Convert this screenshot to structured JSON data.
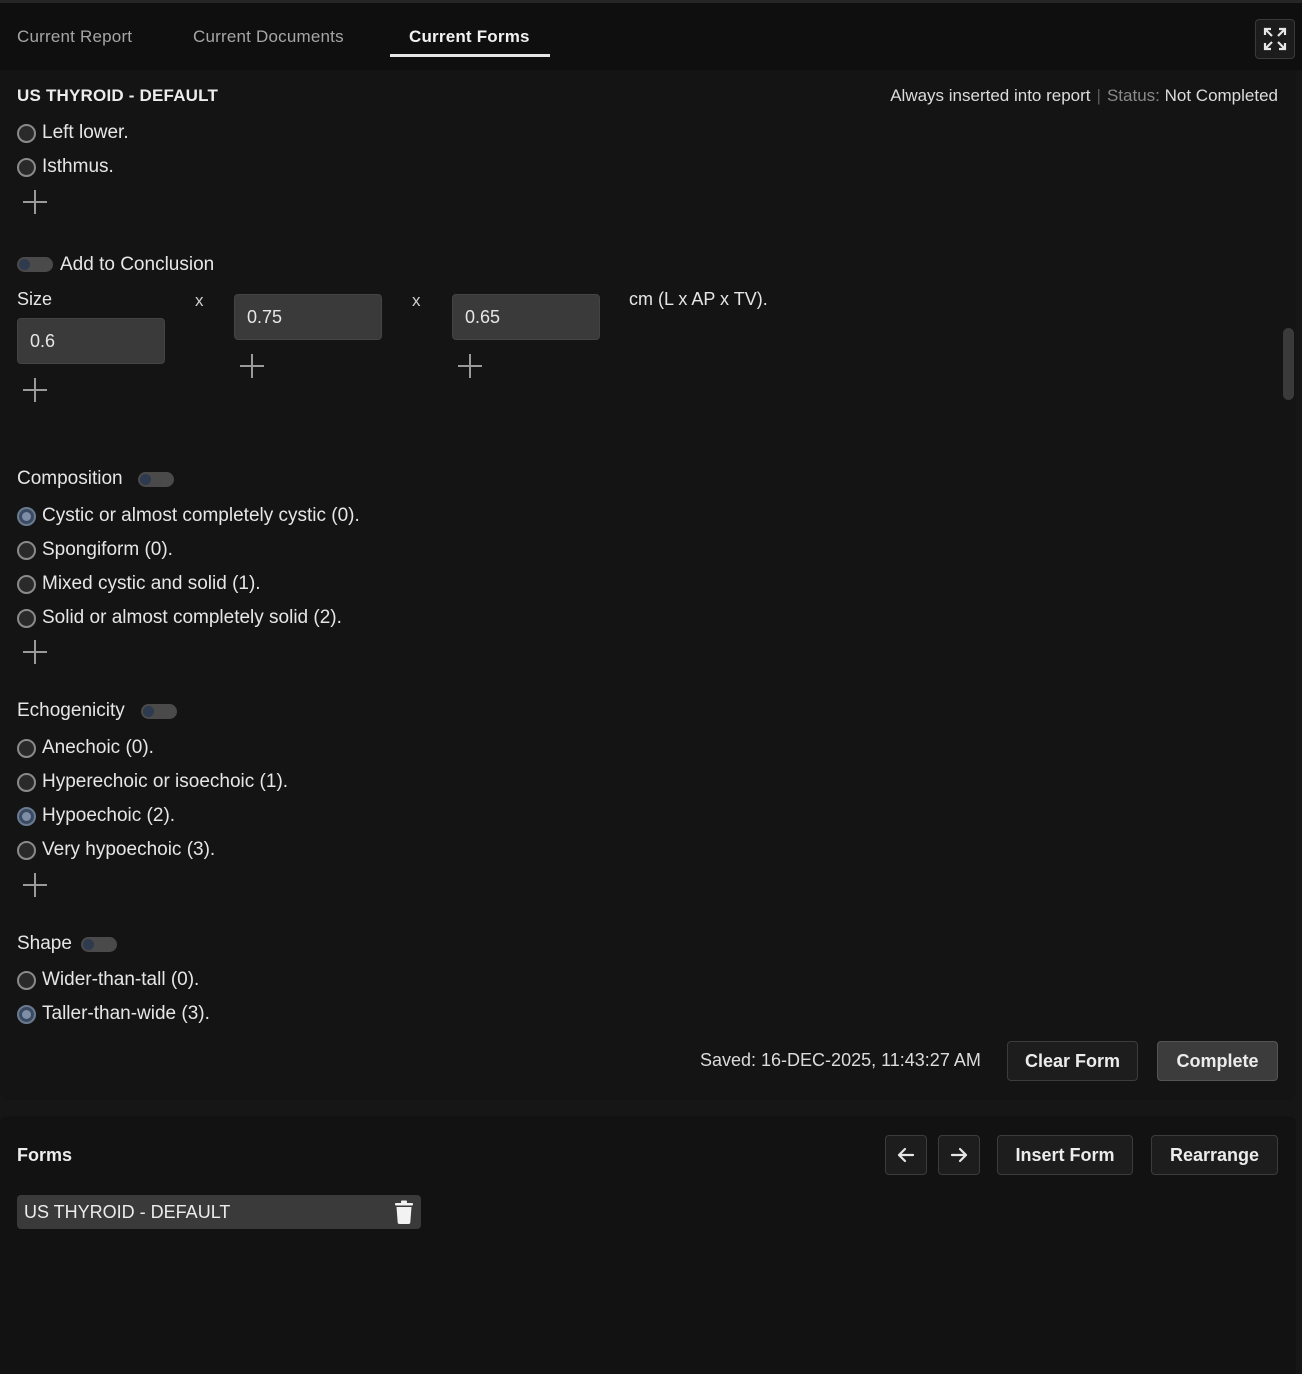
{
  "tabs": [
    {
      "label": "Current Report",
      "active": false
    },
    {
      "label": "Current Documents",
      "active": false
    },
    {
      "label": "Current Forms",
      "active": true
    }
  ],
  "form": {
    "title": "US THYROID - DEFAULT",
    "insert_note": "Always inserted into report",
    "separator": "|",
    "status_label": "Status:",
    "status_value": "Not Completed",
    "location_options": [
      {
        "label": "Left lower.",
        "checked": false
      },
      {
        "label": "Isthmus.",
        "checked": false
      }
    ],
    "add_to_conclusion_label": "Add to Conclusion",
    "size": {
      "label": "Size",
      "x_symbol": "x",
      "values": [
        "0.6",
        "0.75",
        "0.65"
      ],
      "unit": "cm (L x AP x TV)."
    },
    "composition": {
      "label": "Composition",
      "options": [
        {
          "label": "Cystic or almost completely cystic (0).",
          "checked": true
        },
        {
          "label": "Spongiform (0).",
          "checked": false
        },
        {
          "label": "Mixed cystic and solid (1).",
          "checked": false
        },
        {
          "label": "Solid or almost completely solid (2).",
          "checked": false
        }
      ]
    },
    "echogenicity": {
      "label": "Echogenicity",
      "options": [
        {
          "label": "Anechoic (0).",
          "checked": false
        },
        {
          "label": "Hyperechoic or isoechoic (1).",
          "checked": false
        },
        {
          "label": "Hypoechoic (2).",
          "checked": true
        },
        {
          "label": "Very hypoechoic (3).",
          "checked": false
        }
      ]
    },
    "shape": {
      "label": "Shape",
      "options": [
        {
          "label": "Wider-than-tall (0).",
          "checked": false
        },
        {
          "label": "Taller-than-wide (3).",
          "checked": true
        }
      ]
    },
    "saved_text": "Saved: 16-DEC-2025, 11:43:27 AM",
    "clear_label": "Clear Form",
    "complete_label": "Complete"
  },
  "forms_panel": {
    "title": "Forms",
    "insert_label": "Insert Form",
    "rearrange_label": "Rearrange",
    "items": [
      {
        "label": "US THYROID - DEFAULT"
      }
    ]
  },
  "icons": {
    "expand": "expand-icon",
    "prev": "arrow-left-icon",
    "next": "arrow-right-icon",
    "delete": "trash-icon",
    "add": "plus-icon"
  }
}
